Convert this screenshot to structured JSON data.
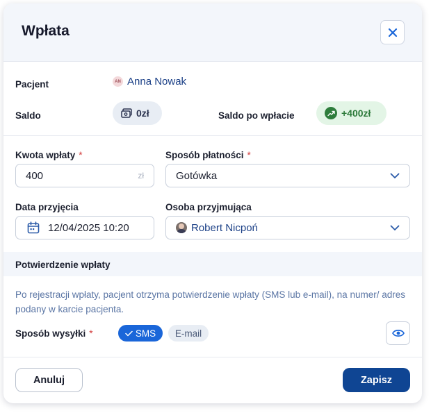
{
  "modal": {
    "title": "Wpłata",
    "close_icon": "close-icon"
  },
  "patient": {
    "label": "Pacjent",
    "initials": "AN",
    "name": "Anna Nowak"
  },
  "balance": {
    "label": "Saldo",
    "value": "0zł",
    "icon": "wallet-icon",
    "after_label": "Saldo po wpłacie",
    "after_value": "+400zł",
    "after_icon": "trending-up-icon"
  },
  "form": {
    "amount": {
      "label": "Kwota wpłaty",
      "required_mark": "*",
      "value": "400",
      "unit": "zł"
    },
    "method": {
      "label": "Sposób płatności",
      "required_mark": "*",
      "value": "Gotówka"
    },
    "date": {
      "label": "Data przyjęcia",
      "value": "12/04/2025 10:20",
      "icon": "calendar-icon"
    },
    "person": {
      "label": "Osoba przyjmująca",
      "value": "Robert Nicpoń"
    }
  },
  "confirmation": {
    "title": "Potwierdzenie wpłaty",
    "info": "Po rejestracji wpłaty, pacjent otrzyma potwierdzenie wpłaty (SMS lub e-mail), na numer/ adres podany w karcie pacjenta.",
    "send_label": "Sposób wysyłki",
    "required_mark": "*",
    "options": [
      {
        "label": "SMS",
        "selected": true
      },
      {
        "label": "E-mail",
        "selected": false
      }
    ],
    "preview_icon": "eye-icon"
  },
  "footer": {
    "cancel_label": "Anuluj",
    "save_label": "Zapisz"
  },
  "colors": {
    "primary": "#0f4593",
    "accent": "#1a66d9",
    "success": "#2e7d3c",
    "required": "#d23a3a",
    "link": "#1a3f86"
  }
}
